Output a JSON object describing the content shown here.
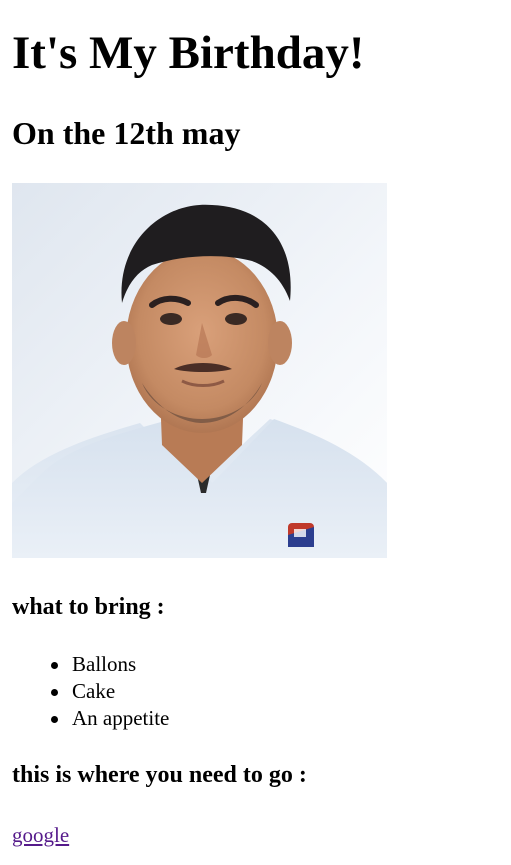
{
  "title": "It's My Birthday!",
  "subtitle": "On the 12th may",
  "photo": {
    "icon": "portrait-photo",
    "alt": "portrait of a young man in a light blue shirt"
  },
  "bring": {
    "heading": "what to bring :",
    "items": [
      "Ballons",
      "Cake",
      "An appetite"
    ]
  },
  "directions": {
    "heading": "this is where you need to go :",
    "link_label": "google"
  },
  "colors": {
    "visited_link": "#551a8b",
    "text": "#000000",
    "background": "#ffffff"
  }
}
